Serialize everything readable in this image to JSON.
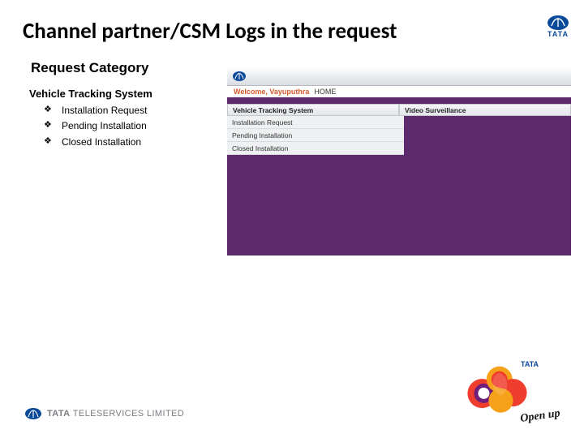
{
  "title": "Channel partner/CSM Logs in the request",
  "section": {
    "title": "Request Category",
    "subtitle": "Vehicle Tracking System",
    "bullet_symbol": "❖",
    "items": [
      "Installation Request",
      "Pending Installation",
      "Closed Installation"
    ]
  },
  "screenshot": {
    "welcome_label": "Welcome,",
    "welcome_user": "Vayuputhra",
    "home": "HOME",
    "tabs": [
      "Vehicle Tracking System",
      "Video Surveillance"
    ],
    "menu": [
      "Installation Request",
      "Pending Installation",
      "Closed Installation"
    ]
  },
  "footer": {
    "tata": "TATA",
    "company": "TELESERVICES LIMITED"
  },
  "docomo": {
    "tata": "TATA",
    "tagline": "Open up"
  }
}
